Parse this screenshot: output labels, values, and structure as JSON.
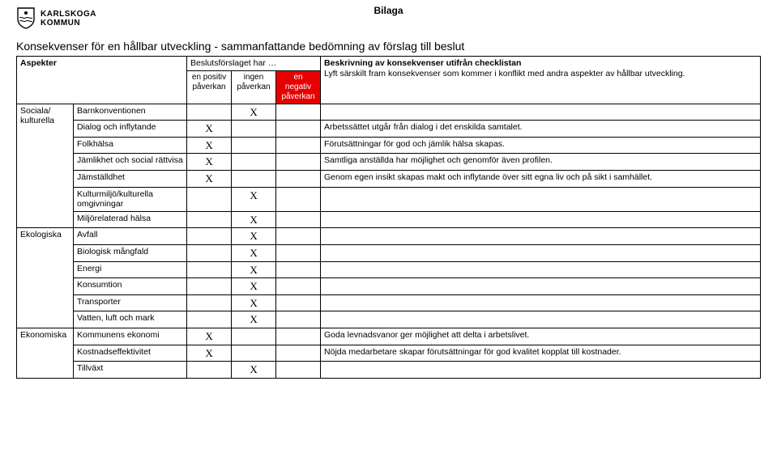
{
  "attachment_label": "Bilaga",
  "org": {
    "line1": "KARLSKOGA",
    "line2": "KOMMUN"
  },
  "title": "Konsekvenser för en hållbar utveckling - sammanfattande bedömning av förslag till beslut",
  "headers": {
    "aspekter": "Aspekter",
    "proposal_has": "Beslutsförslaget har …",
    "pos": "en positiv påverkan",
    "none": "ingen påverkan",
    "neg": "en negativ påverkan",
    "desc_title": "Beskrivning av konsekvenser utifrån checklistan",
    "desc_sub": "Lyft särskilt fram konsekvenser som kommer i konflikt med andra aspekter av hållbar utveckling."
  },
  "groups": {
    "social": "Sociala/ kulturella",
    "eco": "Ekologiska",
    "econ": "Ekonomiska"
  },
  "rows": {
    "barnkonv": {
      "label": "Barnkonventionen",
      "pos": "",
      "none": "X",
      "neg": "",
      "desc": ""
    },
    "dialog": {
      "label": "Dialog och inflytande",
      "pos": "X",
      "none": "",
      "neg": "",
      "desc": "Arbetssättet utgår från dialog i det enskilda samtalet."
    },
    "folkhalsa": {
      "label": "Folkhälsa",
      "pos": "X",
      "none": "",
      "neg": "",
      "desc": "Förutsättningar för god och jämlik hälsa skapas."
    },
    "jamlikhet": {
      "label": "Jämlikhet och social rättvisa",
      "pos": "X",
      "none": "",
      "neg": "",
      "desc": "Samtliga anställda har möjlighet och genomför även profilen."
    },
    "jamstalld": {
      "label": "Jämställdhet",
      "pos": "X",
      "none": "",
      "neg": "",
      "desc": "Genom egen insikt skapas makt och inflytande över sitt egna liv och på sikt i samhället."
    },
    "kultur": {
      "label": "Kulturmiljö/kulturella omgivningar",
      "pos": "",
      "none": "X",
      "neg": "",
      "desc": ""
    },
    "miljo": {
      "label": "Miljörelaterad hälsa",
      "pos": "",
      "none": "X",
      "neg": "",
      "desc": ""
    },
    "avfall": {
      "label": "Avfall",
      "pos": "",
      "none": "X",
      "neg": "",
      "desc": ""
    },
    "biologisk": {
      "label": "Biologisk mångfald",
      "pos": "",
      "none": "X",
      "neg": "",
      "desc": ""
    },
    "energi": {
      "label": "Energi",
      "pos": "",
      "none": "X",
      "neg": "",
      "desc": ""
    },
    "konsum": {
      "label": "Konsumtion",
      "pos": "",
      "none": "X",
      "neg": "",
      "desc": ""
    },
    "transport": {
      "label": "Transporter",
      "pos": "",
      "none": "X",
      "neg": "",
      "desc": ""
    },
    "vatten": {
      "label": "Vatten, luft och mark",
      "pos": "",
      "none": "X",
      "neg": "",
      "desc": ""
    },
    "kommun": {
      "label": "Kommunens ekonomi",
      "pos": "X",
      "none": "",
      "neg": "",
      "desc": "Goda levnadsvanor ger möjlighet att delta i arbetslivet."
    },
    "kostnad": {
      "label": "Kostnadseffektivitet",
      "pos": "X",
      "none": "",
      "neg": "",
      "desc": "Nöjda medarbetare skapar förutsättningar för god kvalitet kopplat till kostnader."
    },
    "tillvaxt": {
      "label": "Tillväxt",
      "pos": "",
      "none": "X",
      "neg": "",
      "desc": ""
    }
  }
}
